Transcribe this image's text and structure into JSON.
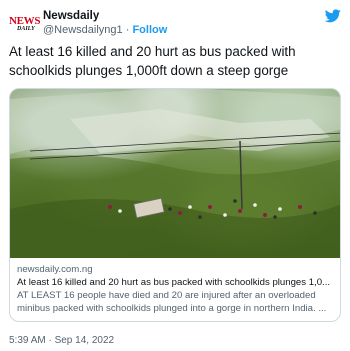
{
  "author": {
    "logo_top": "NEWS",
    "logo_bottom": "DAILY",
    "display_name": "Newsdaily",
    "handle": "@Newsdailyng1",
    "separator": "·",
    "follow_label": "Follow"
  },
  "tweet": {
    "text": "At least 16 killed and 20 hurt as bus packed with schoolkids plunges 1,000ft down a steep gorge",
    "timestamp": "5:39 AM · Sep 14, 2022"
  },
  "card": {
    "domain": "newsdaily.com.ng",
    "title": "At least 16 killed and 20 hurt as bus packed with schoolkids plunges 1,0...",
    "description": "AT LEAST 16 people have died and 20 are injured after an overloaded minibus packed with schoolkids plunged into a gorge in northern India. ..."
  },
  "colors": {
    "brand_red": "#d0021b",
    "twitter_blue": "#1d9bf0",
    "secondary_text": "#536471"
  },
  "icons": {
    "platform": "twitter-bird-icon"
  }
}
